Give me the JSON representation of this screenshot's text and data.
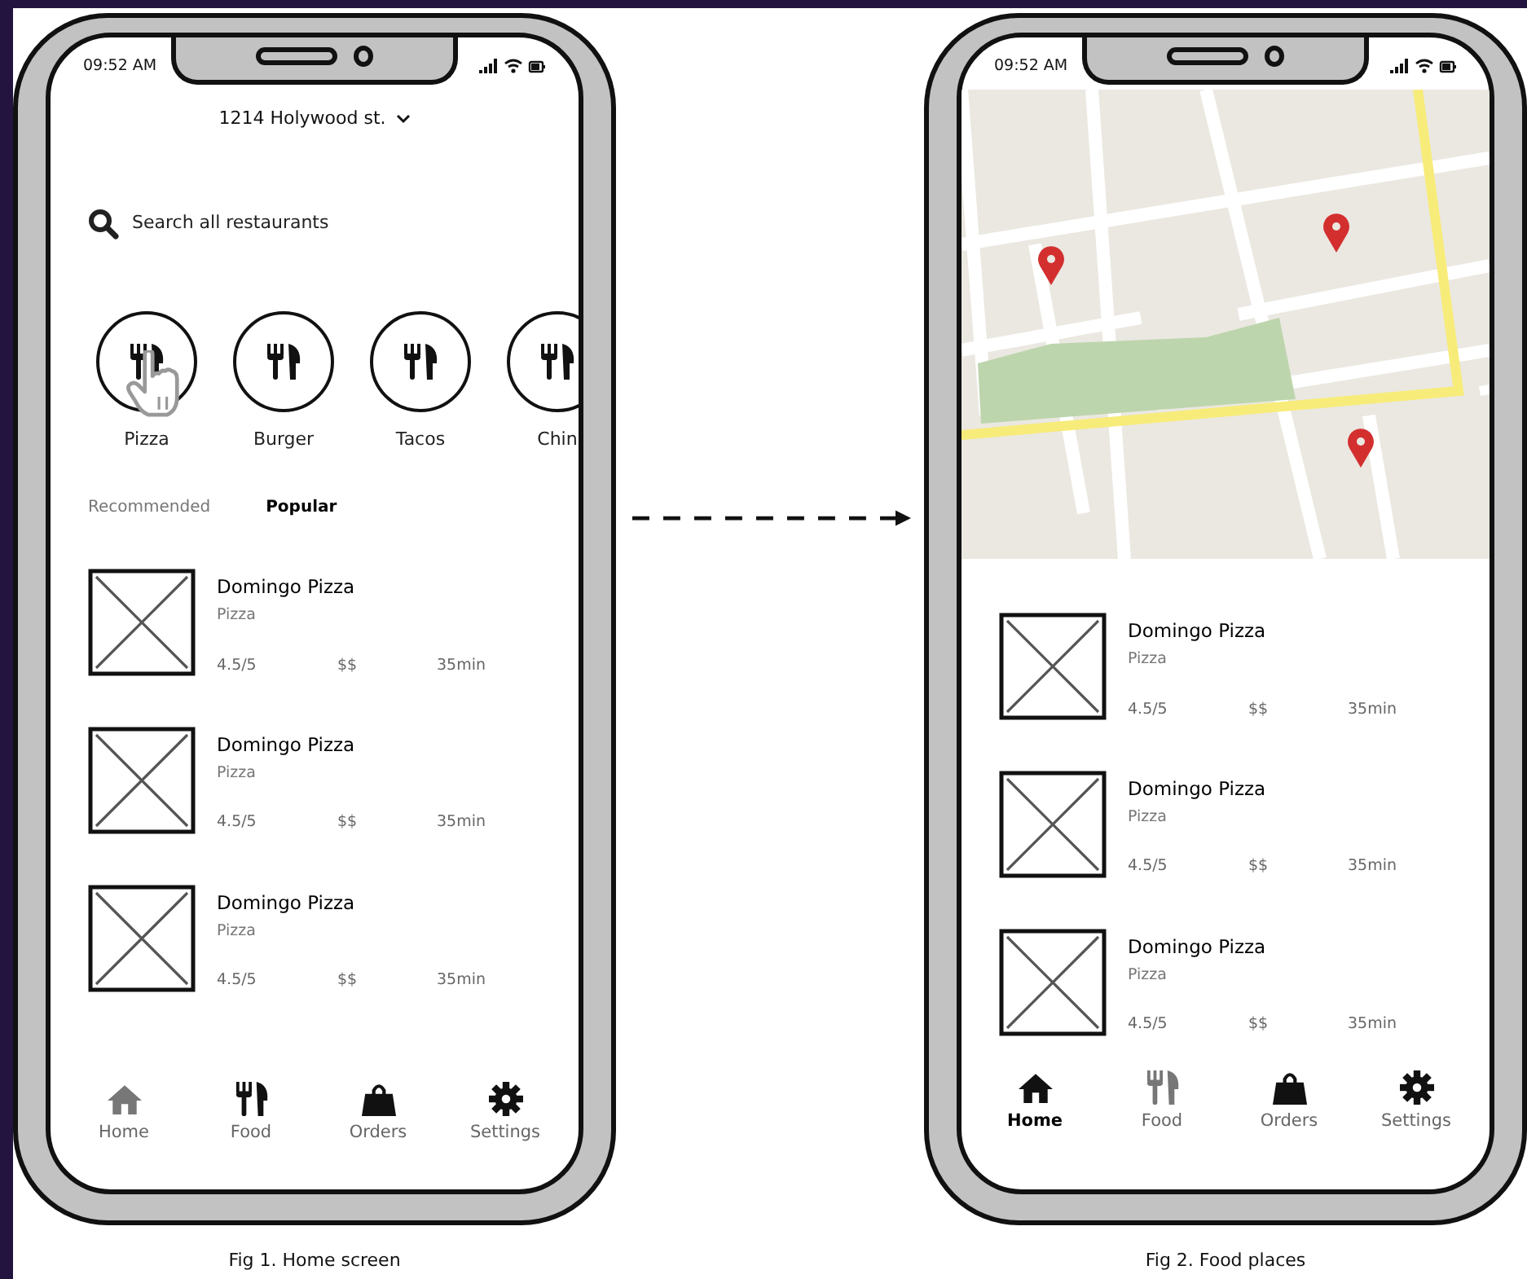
{
  "phones": [
    {
      "status_time": "09:52 AM",
      "address": "1214 Holywood st.",
      "search": {
        "placeholder": "Search all restaurants"
      },
      "categories": [
        {
          "label": "Pizza",
          "pointed": true
        },
        {
          "label": "Burger",
          "pointed": false
        },
        {
          "label": "Tacos",
          "pointed": false
        },
        {
          "label": "Chin",
          "pointed": false
        }
      ],
      "tabs": [
        {
          "label": "Recommended",
          "selected": false
        },
        {
          "label": "Popular",
          "selected": true
        }
      ],
      "restaurants": [
        {
          "name": "Domingo Pizza",
          "cuisine": "Pizza",
          "rating": "4.5/5",
          "price": "$$",
          "time": "35min"
        },
        {
          "name": "Domingo Pizza",
          "cuisine": "Pizza",
          "rating": "4.5/5",
          "price": "$$",
          "time": "35min"
        },
        {
          "name": "Domingo Pizza",
          "cuisine": "Pizza",
          "rating": "4.5/5",
          "price": "$$",
          "time": "35min"
        }
      ],
      "nav": [
        {
          "kind": "home",
          "label": "Home",
          "selected": false,
          "dimmed": true
        },
        {
          "kind": "food",
          "label": "Food",
          "selected": false,
          "dimmed": false
        },
        {
          "kind": "orders",
          "label": "Orders",
          "selected": false,
          "dimmed": false
        },
        {
          "kind": "settings",
          "label": "Settings",
          "selected": false,
          "dimmed": false
        }
      ],
      "caption": "Fig 1. Home screen"
    },
    {
      "status_time": "09:52 AM",
      "map": {
        "kind": "picture"
      },
      "restaurants": [
        {
          "name": "Domingo Pizza",
          "cuisine": "Pizza",
          "rating": "4.5/5",
          "price": "$$",
          "time": "35min"
        },
        {
          "name": "Domingo Pizza",
          "cuisine": "Pizza",
          "rating": "4.5/5",
          "price": "$$",
          "time": "35min"
        },
        {
          "name": "Domingo Pizza",
          "cuisine": "Pizza",
          "rating": "4.5/5",
          "price": "$$",
          "time": "35min"
        }
      ],
      "nav": [
        {
          "kind": "home",
          "label": "Home",
          "selected": true,
          "dimmed": false
        },
        {
          "kind": "food",
          "label": "Food",
          "selected": false,
          "dimmed": true
        },
        {
          "kind": "orders",
          "label": "Orders",
          "selected": false,
          "dimmed": false
        },
        {
          "kind": "settings",
          "label": "Settings",
          "selected": false,
          "dimmed": false
        }
      ],
      "caption": "Fig 2. Food places"
    }
  ]
}
